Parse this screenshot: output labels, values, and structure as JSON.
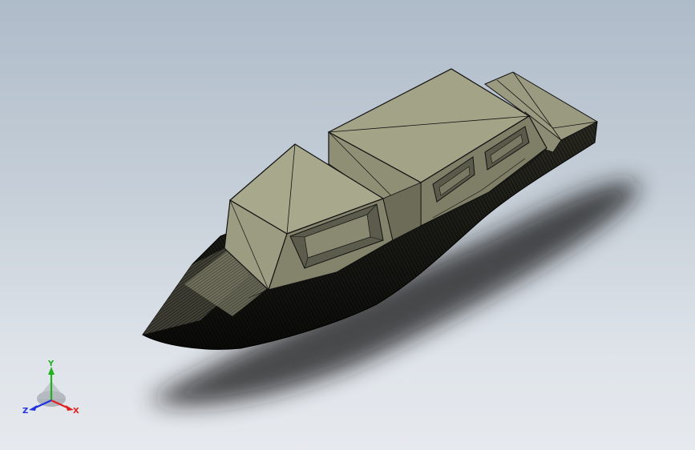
{
  "viewport": {
    "background_top": "#aebbc9",
    "background_bottom": "#e6e9ee"
  },
  "model": {
    "name": "boat",
    "surface_color": "#9e9e84",
    "surface_dark": "#6e6e5a",
    "edge_color": "#111111",
    "shadow_color": "#1a1a1a"
  },
  "triad": {
    "x_label": "X",
    "y_label": "Y",
    "z_label": "Z",
    "x_color": "#e02020",
    "y_color": "#20b020",
    "z_color": "#2030e0"
  }
}
